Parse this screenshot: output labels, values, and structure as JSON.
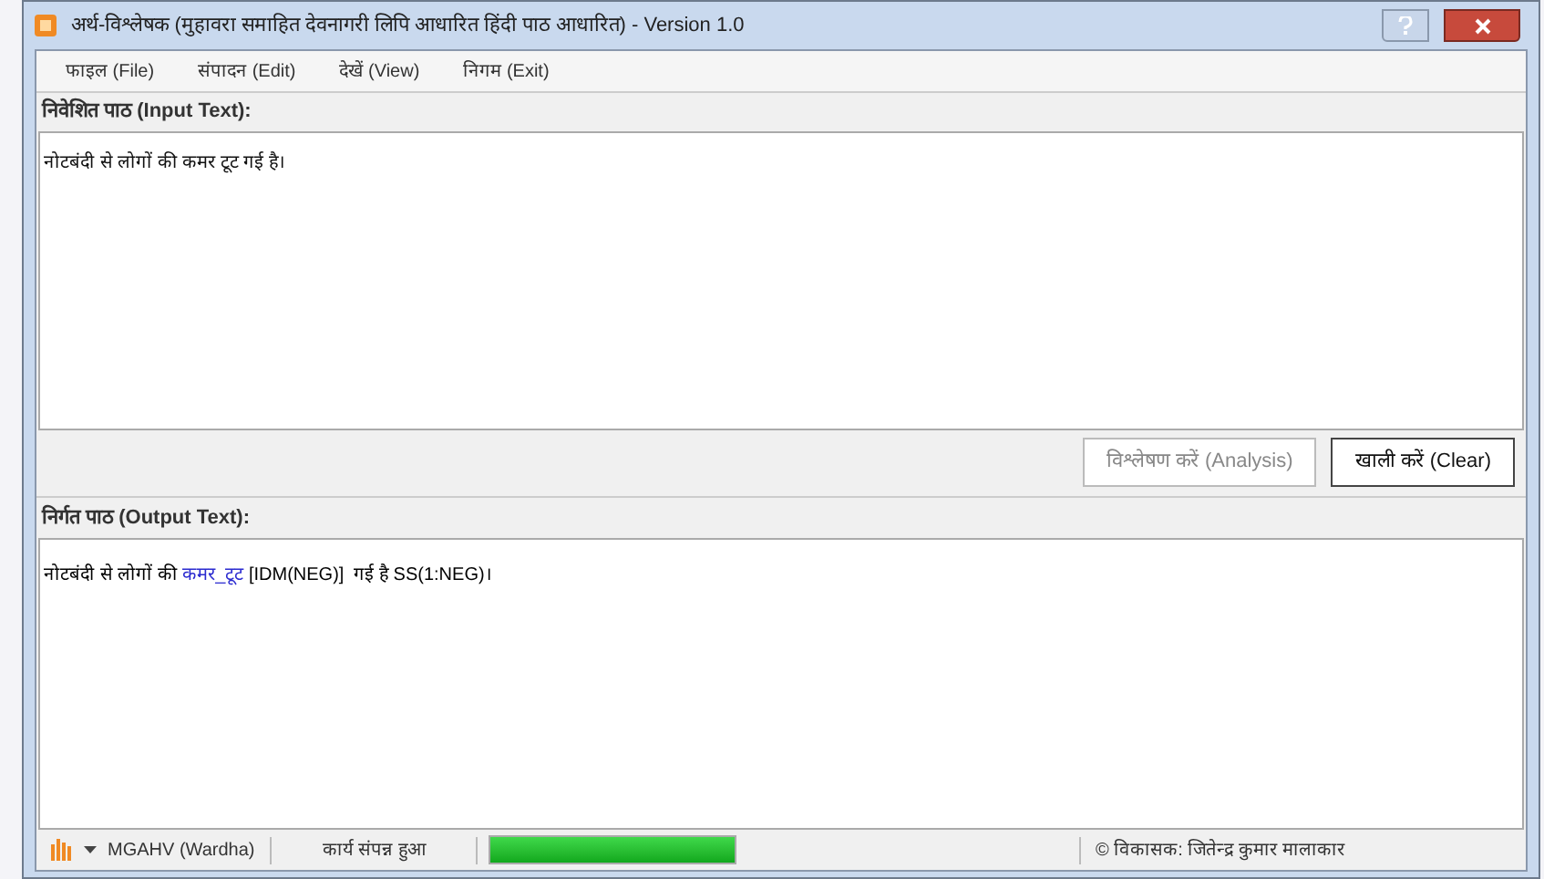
{
  "window": {
    "title": "अर्थ-विश्लेषक (मुहावरा समाहित देवनागरी लिपि आधारित हिंदी पाठ आधारित) - Version 1.0"
  },
  "menu": [
    "फाइल (File)",
    "संपादन (Edit)",
    "देखें (View)",
    "निगम (Exit)"
  ],
  "input": {
    "label": "निवेशित पाठ (Input Text):",
    "value": "नोटबंदी से लोगों की कमर टूट गई है।"
  },
  "buttons": [
    {
      "label": "विश्लेषण करें (Analysis)",
      "disabled": true
    },
    {
      "label": "खाली करें (Clear)",
      "disabled": false
    }
  ],
  "output": {
    "label": "निर्गत पाठ (Output Text):",
    "segments": [
      {
        "text": "नोटबंदी से लोगों की ",
        "color": "#000000"
      },
      {
        "text": "कमर_टूट",
        "color": "#2b2bd0"
      },
      {
        "text": " [IDM(NEG)]  गई है SS(1:NEG)।",
        "color": "#000000"
      }
    ]
  },
  "status_bar": {
    "org": "MGAHV (Wardha)",
    "message": "कार्य संपन्न हुआ",
    "level": 1,
    "credit": "© विकासक: जितेन्द्र कुमार मालाकार"
  }
}
